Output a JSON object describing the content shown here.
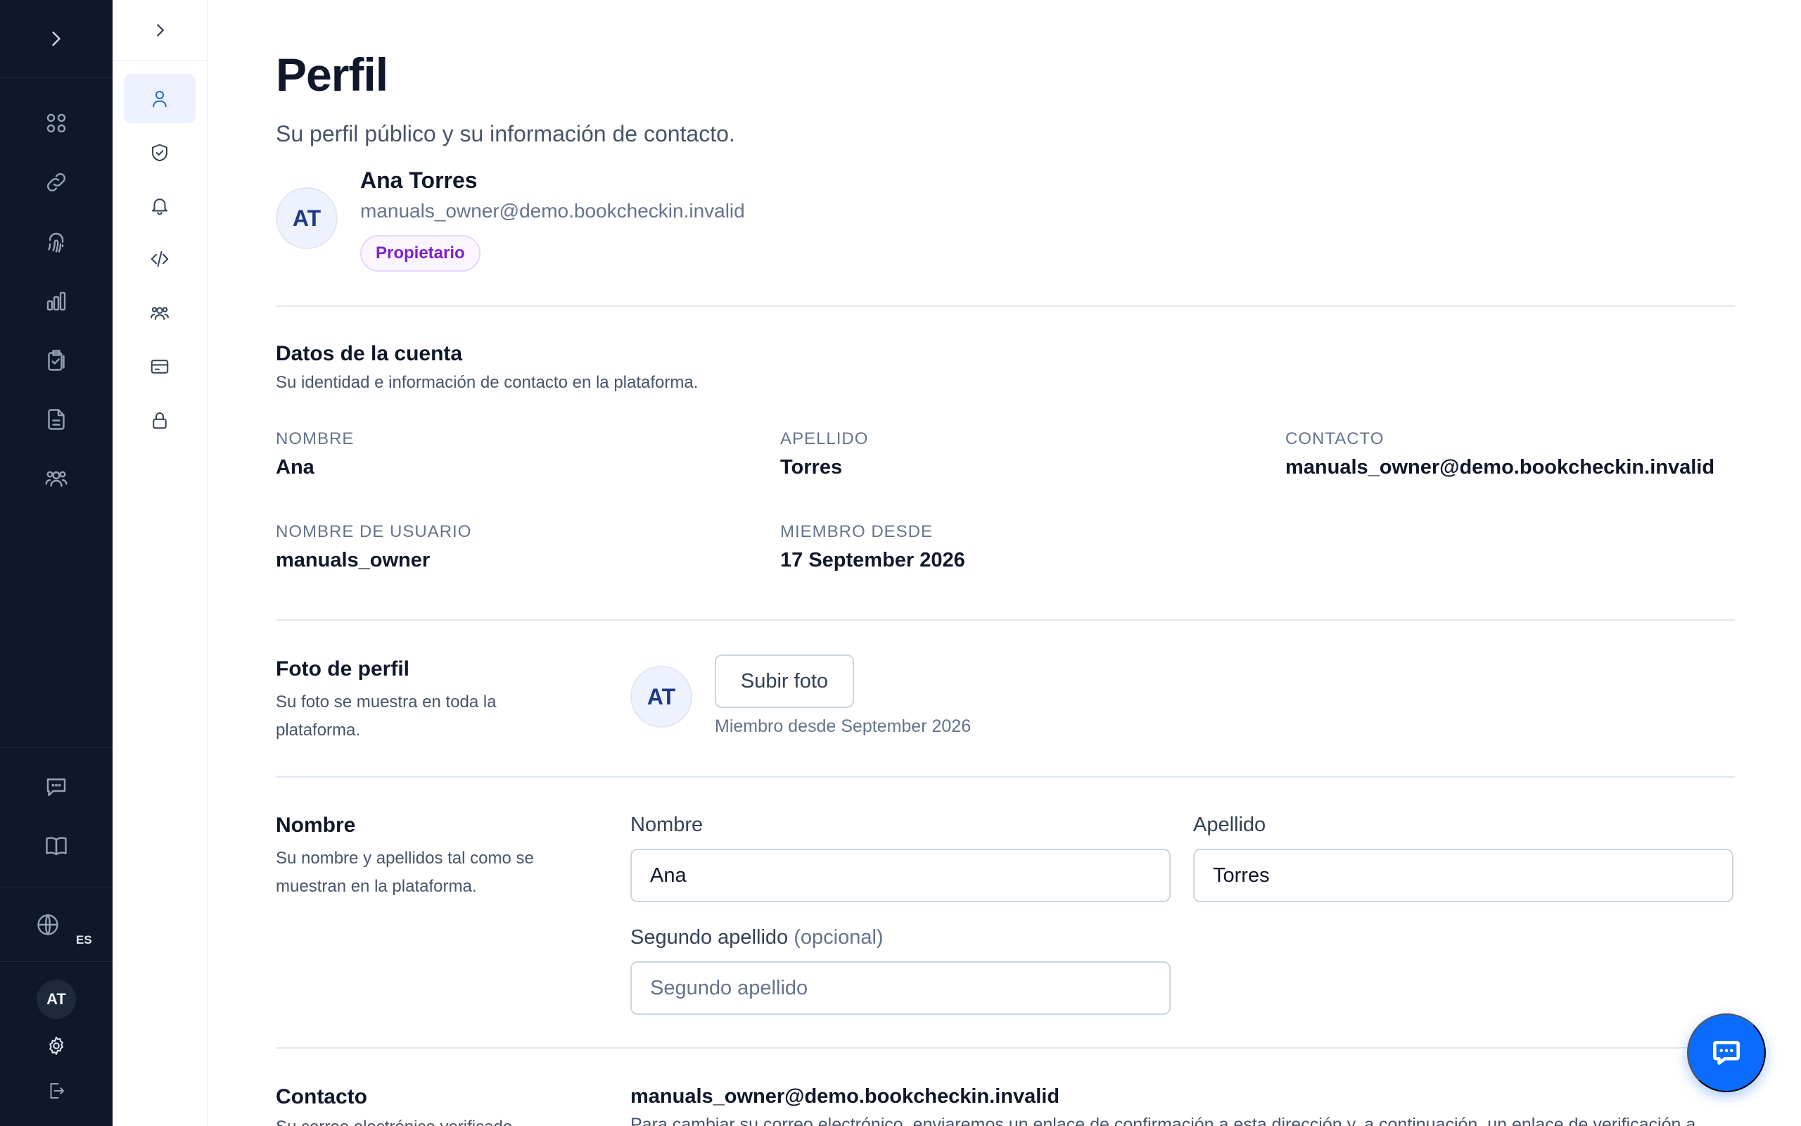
{
  "rail": {
    "icons": [
      "chevron-right-icon",
      "grid-icon",
      "link-icon",
      "fingerprint-icon",
      "bar-chart-icon",
      "clipboard-check-icon",
      "document-icon",
      "users-icon",
      "chat-icon",
      "book-icon",
      "globe-icon",
      "settings-icon",
      "logout-icon"
    ],
    "language_code": "ES",
    "user_initials": "AT"
  },
  "subnav": {
    "items": [
      "user-icon",
      "shield-check-icon",
      "bell-icon",
      "code-icon",
      "team-icon",
      "credit-card-icon",
      "lock-icon"
    ],
    "active_item": "user-icon"
  },
  "page": {
    "title": "Perfil",
    "subtitle": "Su perfil público y su información de contacto."
  },
  "profile": {
    "initials": "AT",
    "name": "Ana Torres",
    "email": "manuals_owner@demo.bookcheckin.invalid",
    "role": "Propietario"
  },
  "account": {
    "title": "Datos de la cuenta",
    "description": "Su identidad e información de contacto en la plataforma.",
    "fields": {
      "first_name_label": "NOMBRE",
      "first_name": "Ana",
      "last_name_label": "APELLIDO",
      "last_name": "Torres",
      "contact_label": "CONTACTO",
      "contact": "manuals_owner@demo.bookcheckin.invalid",
      "username_label": "NOMBRE DE USUARIO",
      "username": "manuals_owner",
      "member_since_label": "MIEMBRO DESDE",
      "member_since": "17 September 2026"
    }
  },
  "photo": {
    "title": "Foto de perfil",
    "description_line1": "Su foto se muestra en toda la",
    "description_line2": "plataforma.",
    "initials": "AT",
    "upload_label": "Subir foto",
    "member_since": "Miembro desde September 2026"
  },
  "name_section": {
    "title": "Nombre",
    "description_line1": "Su nombre y apellidos tal como se",
    "description_line2": "muestran en la plataforma.",
    "first_name_label": "Nombre",
    "first_name_value": "Ana",
    "last_name_label": "Apellido",
    "last_name_value": "Torres",
    "second_last_name_label": "Segundo apellido",
    "second_last_name_optional": "(opcional)",
    "second_last_name_placeholder": "Segundo apellido"
  },
  "contact_section": {
    "title": "Contacto",
    "description": "Su correo electrónico verificado",
    "email": "manuals_owner@demo.bookcheckin.invalid",
    "note": "Para cambiar su correo electrónico, enviaremos un enlace de confirmación a esta dirección y, a continuación, un enlace de verificación a"
  },
  "colors": {
    "rail_bg": "#0f172a",
    "accent": "#0b6bff",
    "active_nav_bg": "#eef2ff",
    "badge_purple": "#7e22ce"
  }
}
